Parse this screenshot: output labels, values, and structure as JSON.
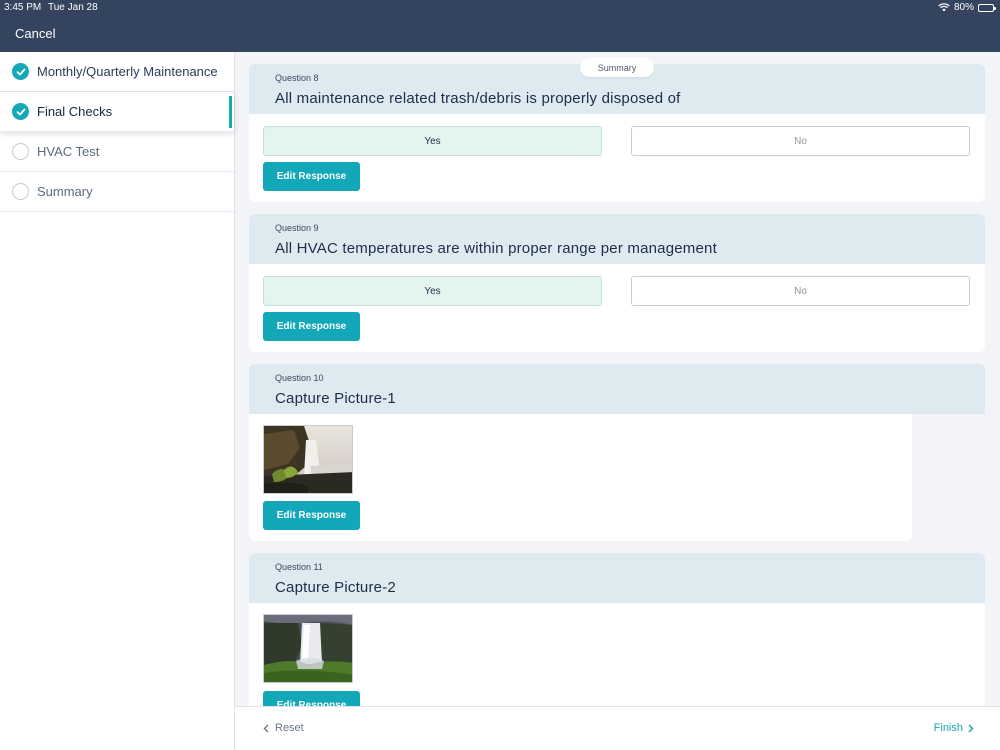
{
  "status_bar": {
    "time": "3:45 PM",
    "date": "Tue Jan 28",
    "battery": "80%",
    "battery_level": 0.8
  },
  "header": {
    "cancel_label": "Cancel"
  },
  "sidebar": {
    "items": [
      {
        "label": "Monthly/Quarterly Maintenance",
        "state": "complete"
      },
      {
        "label": "Final Checks",
        "state": "complete"
      },
      {
        "label": "HVAC Test",
        "state": "pending"
      },
      {
        "label": "Summary",
        "state": "pending"
      }
    ]
  },
  "summary_pill": "Summary",
  "questions": [
    {
      "number": "Question 8",
      "title": "All maintenance related trash/debris is properly disposed of",
      "yes_label": "Yes",
      "no_label": "No",
      "selected": "Yes",
      "edit_label": "Edit Response"
    },
    {
      "number": "Question 9",
      "title": "All HVAC temperatures are within proper range per management",
      "yes_label": "Yes",
      "no_label": "No",
      "selected": "Yes",
      "edit_label": "Edit Response"
    },
    {
      "number": "Question 10",
      "title": "Capture Picture-1",
      "edit_label": "Edit Response",
      "image": "waterfall-coast-photo"
    },
    {
      "number": "Question 11",
      "title": "Capture Picture-2",
      "edit_label": "Edit Response",
      "image": "waterfall-cliff-photo"
    }
  ],
  "footer": {
    "reset_label": "Reset",
    "finish_label": "Finish"
  },
  "colors": {
    "accent": "#12a8b8",
    "header": "#34445e",
    "card_head": "#dfe9f0",
    "yes_selected": "#e4f5ef"
  }
}
